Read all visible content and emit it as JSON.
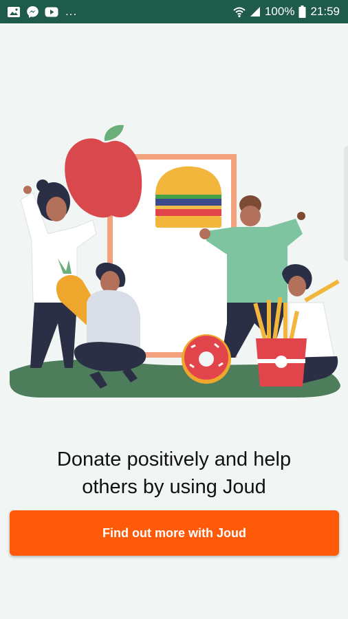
{
  "status_bar": {
    "notification_icons": [
      "gallery-icon",
      "messenger-icon",
      "youtube-icon"
    ],
    "more_indicator": "...",
    "wifi_icon": "wifi-icon",
    "signal_icon": "signal-icon",
    "battery_percent": "100%",
    "battery_icon": "battery-icon",
    "time": "21:59"
  },
  "illustration": {
    "description_icon": "people-donating-food-illustration"
  },
  "headline": {
    "line1": "Donate positively and help",
    "line2": "others by using Joud"
  },
  "cta_button": {
    "label": "Find out more with Joud"
  },
  "colors": {
    "status_bar": "#1f5b4b",
    "background": "#f1f5f3",
    "accent": "#ff5a0a"
  }
}
